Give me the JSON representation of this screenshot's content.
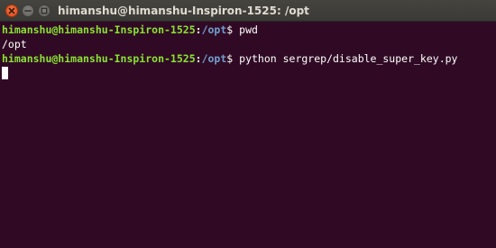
{
  "window": {
    "title": "himanshu@himanshu-Inspiron-1525: /opt",
    "buttons": [
      "close-icon",
      "minimize-icon",
      "maximize-icon"
    ]
  },
  "terminal": {
    "lines": [
      {
        "user_host": "himanshu@himanshu-Inspiron-1525",
        "sep": ":",
        "path": "/opt",
        "prompt": "$ ",
        "command": "pwd"
      },
      {
        "output": "/opt"
      },
      {
        "user_host": "himanshu@himanshu-Inspiron-1525",
        "sep": ":",
        "path": "/opt",
        "prompt": "$ ",
        "command": "python sergrep/disable_super_key.py"
      }
    ]
  },
  "colors": {
    "background": "#300a24",
    "prompt_user": "#8ae234",
    "prompt_path": "#729fcf",
    "text": "#ffffff",
    "close_button": "#df4a16"
  }
}
